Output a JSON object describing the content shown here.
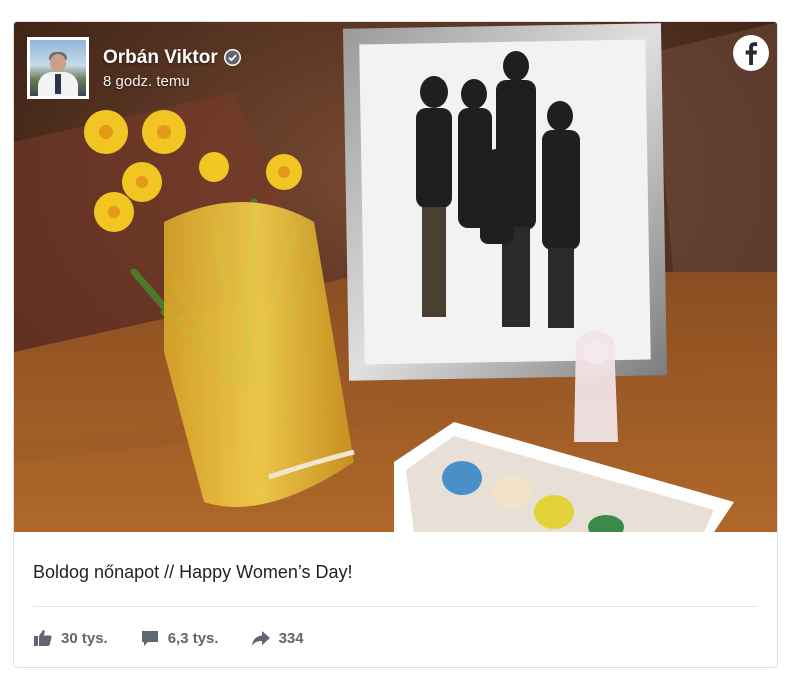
{
  "post": {
    "author": "Orbán Viktor",
    "time": "8 godz. temu",
    "caption": "Boldog nőnapot // Happy Women’s Day!"
  },
  "icons": {
    "verified": "verified-badge-icon",
    "brand": "facebook-logo-icon",
    "like": "thumbs-up-icon",
    "comment": "comment-bubble-icon",
    "share": "share-arrow-icon"
  },
  "stats": {
    "likes": "30 tys.",
    "comments": "6,3 tys.",
    "shares": "334"
  },
  "colors": {
    "text": "#1d2129",
    "meta": "#606770",
    "border": "#dddfe2"
  }
}
